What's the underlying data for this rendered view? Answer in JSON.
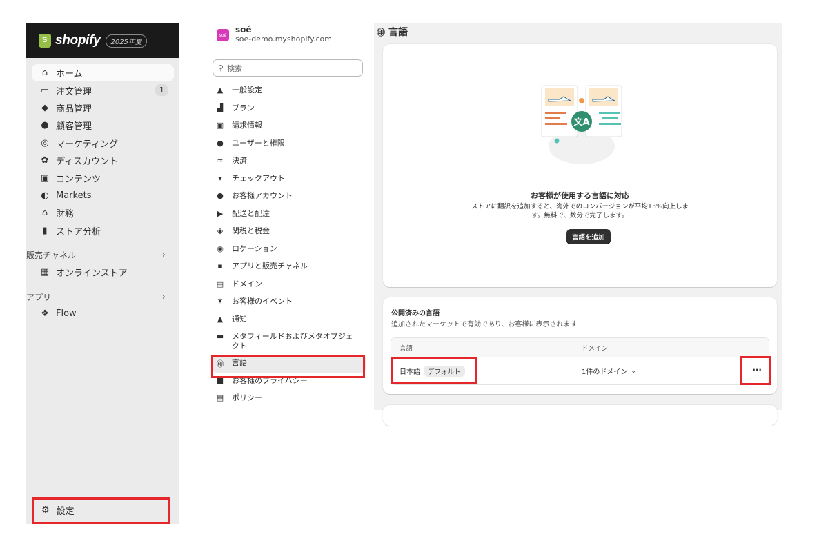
{
  "topbar": {
    "brand": "shopify",
    "badge": "2025年夏"
  },
  "nav": {
    "items": [
      {
        "label": "ホーム",
        "icon": "home-icon",
        "glyph": "⌂",
        "active": true
      },
      {
        "label": "注文管理",
        "icon": "inbox-icon",
        "glyph": "▭",
        "count": "1"
      },
      {
        "label": "商品管理",
        "icon": "tag-icon",
        "glyph": "◆"
      },
      {
        "label": "顧客管理",
        "icon": "person-icon",
        "glyph": "●"
      },
      {
        "label": "マーケティング",
        "icon": "target-icon",
        "glyph": "◎"
      },
      {
        "label": "ディスカウント",
        "icon": "discount-icon",
        "glyph": "✿"
      },
      {
        "label": "コンテンツ",
        "icon": "content-icon",
        "glyph": "▣"
      },
      {
        "label": "Markets",
        "icon": "globe-icon",
        "glyph": "◐"
      },
      {
        "label": "財務",
        "icon": "bank-icon",
        "glyph": "⌂"
      },
      {
        "label": "ストア分析",
        "icon": "analytics-icon",
        "glyph": "▮"
      }
    ],
    "sales_channels": {
      "label": "販売チャネル",
      "items": [
        {
          "label": "オンラインストア",
          "icon": "store-icon",
          "glyph": "▦"
        }
      ]
    },
    "apps": {
      "label": "アプリ",
      "items": [
        {
          "label": "Flow",
          "icon": "flow-icon",
          "glyph": "❖"
        }
      ]
    },
    "settings": {
      "label": "設定",
      "icon": "gear-icon",
      "glyph": "⚙"
    }
  },
  "store": {
    "logo_text": "soé",
    "name": "soé",
    "domain": "soe-demo.myshopify.com"
  },
  "search": {
    "placeholder": "検索"
  },
  "settings_nav": [
    {
      "label": "一般設定",
      "icon": "store-icon",
      "glyph": "▲"
    },
    {
      "label": "プラン",
      "icon": "plan-icon",
      "glyph": "▟"
    },
    {
      "label": "請求情報",
      "icon": "billing-icon",
      "glyph": "▣"
    },
    {
      "label": "ユーザーと権限",
      "icon": "users-icon",
      "glyph": "●"
    },
    {
      "label": "決済",
      "icon": "payments-icon",
      "glyph": "≈"
    },
    {
      "label": "チェックアウト",
      "icon": "cart-icon",
      "glyph": "▾"
    },
    {
      "label": "お客様アカウント",
      "icon": "account-icon",
      "glyph": "●"
    },
    {
      "label": "配送と配達",
      "icon": "truck-icon",
      "glyph": "▶"
    },
    {
      "label": "関税と税金",
      "icon": "tax-icon",
      "glyph": "◈"
    },
    {
      "label": "ロケーション",
      "icon": "location-icon",
      "glyph": "◉"
    },
    {
      "label": "アプリと販売チャネル",
      "icon": "apps-icon",
      "glyph": "▪"
    },
    {
      "label": "ドメイン",
      "icon": "domain-icon",
      "glyph": "▤"
    },
    {
      "label": "お客様のイベント",
      "icon": "events-icon",
      "glyph": "✶"
    },
    {
      "label": "通知",
      "icon": "bell-icon",
      "glyph": "▲"
    },
    {
      "label": "メタフィールドおよびメタオブジェクト",
      "icon": "metafields-icon",
      "glyph": "▬"
    },
    {
      "label": "言語",
      "icon": "language-icon",
      "glyph": "㊞",
      "selected": true
    },
    {
      "label": "お客様のプライバシー",
      "icon": "lock-icon",
      "glyph": "■"
    },
    {
      "label": "ポリシー",
      "icon": "policy-icon",
      "glyph": "▤"
    }
  ],
  "page": {
    "title": "言語",
    "title_icon": "language-icon"
  },
  "empty_state": {
    "title": "お客様が使用する言語に対応",
    "description": "ストアに翻訳を追加すると、海外でのコンバージョンが平均13%向上します。無料で、数分で完了します。",
    "button": "言語を追加"
  },
  "published": {
    "title": "公開済みの言語",
    "description": "追加されたマーケットで有効であり、お客様に表示されます",
    "columns": [
      "言語",
      "ドメイン"
    ],
    "rows": [
      {
        "language": "日本語",
        "tag": "デフォルト",
        "domain": "1件のドメイン"
      }
    ],
    "more": "···"
  },
  "colors": {
    "highlight": "#e5272b",
    "topbar": "#1a1a1a",
    "accent": "#2f8f6f"
  }
}
